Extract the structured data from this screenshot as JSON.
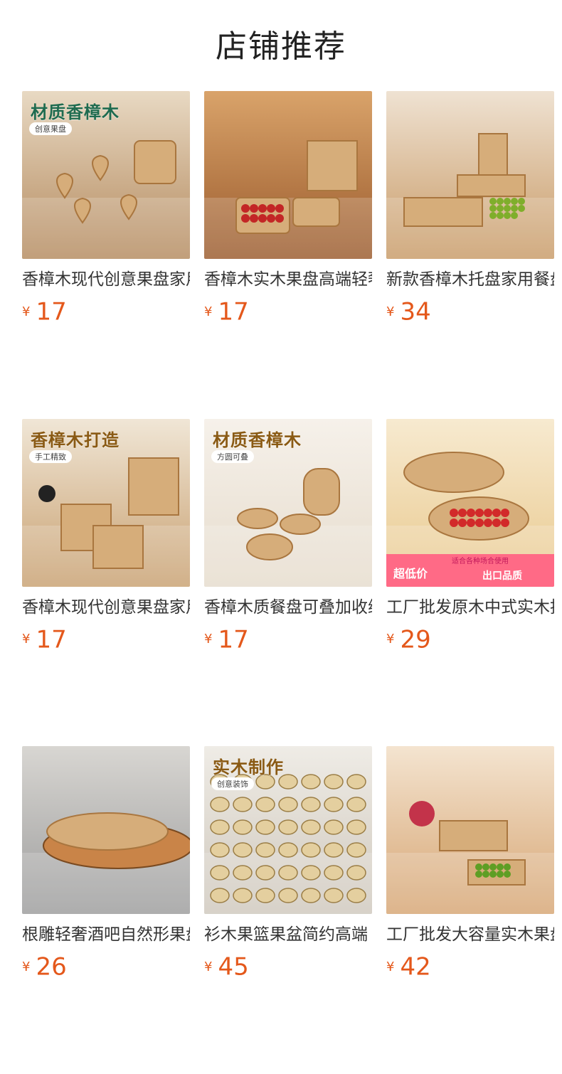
{
  "page_title": "店铺推荐",
  "products": [
    {
      "name": "香樟木现代创意果盘家用",
      "currency": "¥",
      "price": "17",
      "image_text": "材质香樟木",
      "image_subtext": "创意果盘",
      "image_text_color": "#1f6b4f",
      "bg": [
        "#b48a5e",
        "#e8d9c3"
      ],
      "image": "heart-shaped wooden trays"
    },
    {
      "name": "香樟木实木果盘高端轻奢",
      "currency": "¥",
      "price": "17",
      "image_text": "",
      "image_subtext": "",
      "image_text_color": "#333",
      "bg": [
        "#9a5a2c",
        "#d9a36a"
      ],
      "image": "octagon wooden trays in kitchen"
    },
    {
      "name": "新款香樟木托盘家用餐盘",
      "currency": "¥",
      "price": "34",
      "image_text": "",
      "image_subtext": "",
      "image_text_color": "#333",
      "bg": [
        "#c89a66",
        "#efe2d2"
      ],
      "image": "rectangular wooden trays with grapes"
    },
    {
      "name": "香樟木现代创意果盘家用",
      "currency": "¥",
      "price": "17",
      "image_text": "香樟木打造",
      "image_subtext": "手工精致",
      "image_text_color": "#8a5a14",
      "bg": [
        "#c8a070",
        "#f0e6d6"
      ],
      "image": "square wooden trays"
    },
    {
      "name": "香樟木质餐盘可叠加收纳",
      "currency": "¥",
      "price": "17",
      "image_text": "材质香樟木",
      "image_subtext": "方圆可叠",
      "image_text_color": "#8a5a14",
      "bg": [
        "#e6dccd",
        "#f6f1ea"
      ],
      "image": "round wooden bowls"
    },
    {
      "name": "工厂批发原木中式实木托盘",
      "currency": "¥",
      "price": "29",
      "image_text": "",
      "image_subtext": "",
      "image_text_color": "#333",
      "bg": [
        "#e9c98e",
        "#f7ead0"
      ],
      "image": "oval wooden trays with strawberries",
      "promo_left": "超低价",
      "promo_top": "适合各种场合使用",
      "promo_right": "出口品质"
    },
    {
      "name": "根雕轻奢酒吧自然形果盘",
      "currency": "¥",
      "price": "26",
      "image_text": "",
      "image_subtext": "",
      "image_text_color": "#333",
      "bg": [
        "#9c9c9c",
        "#d8d6d2"
      ],
      "image": "natural-shaped root carved trays"
    },
    {
      "name": "衫木果篮果盆简约高端",
      "currency": "¥",
      "price": "45",
      "image_text": "实木制作",
      "image_subtext": "创意装饰",
      "image_text_color": "#8a5a14",
      "bg": [
        "#cfc8bd",
        "#efece6"
      ],
      "image": "many wooden boat-shaped baskets"
    },
    {
      "name": "工厂批发大容量实木果盘",
      "currency": "¥",
      "price": "42",
      "image_text": "",
      "image_subtext": "",
      "image_text_color": "#333",
      "bg": [
        "#d6a573",
        "#f4e4d0"
      ],
      "image": "square wooden trays with grapes"
    }
  ]
}
